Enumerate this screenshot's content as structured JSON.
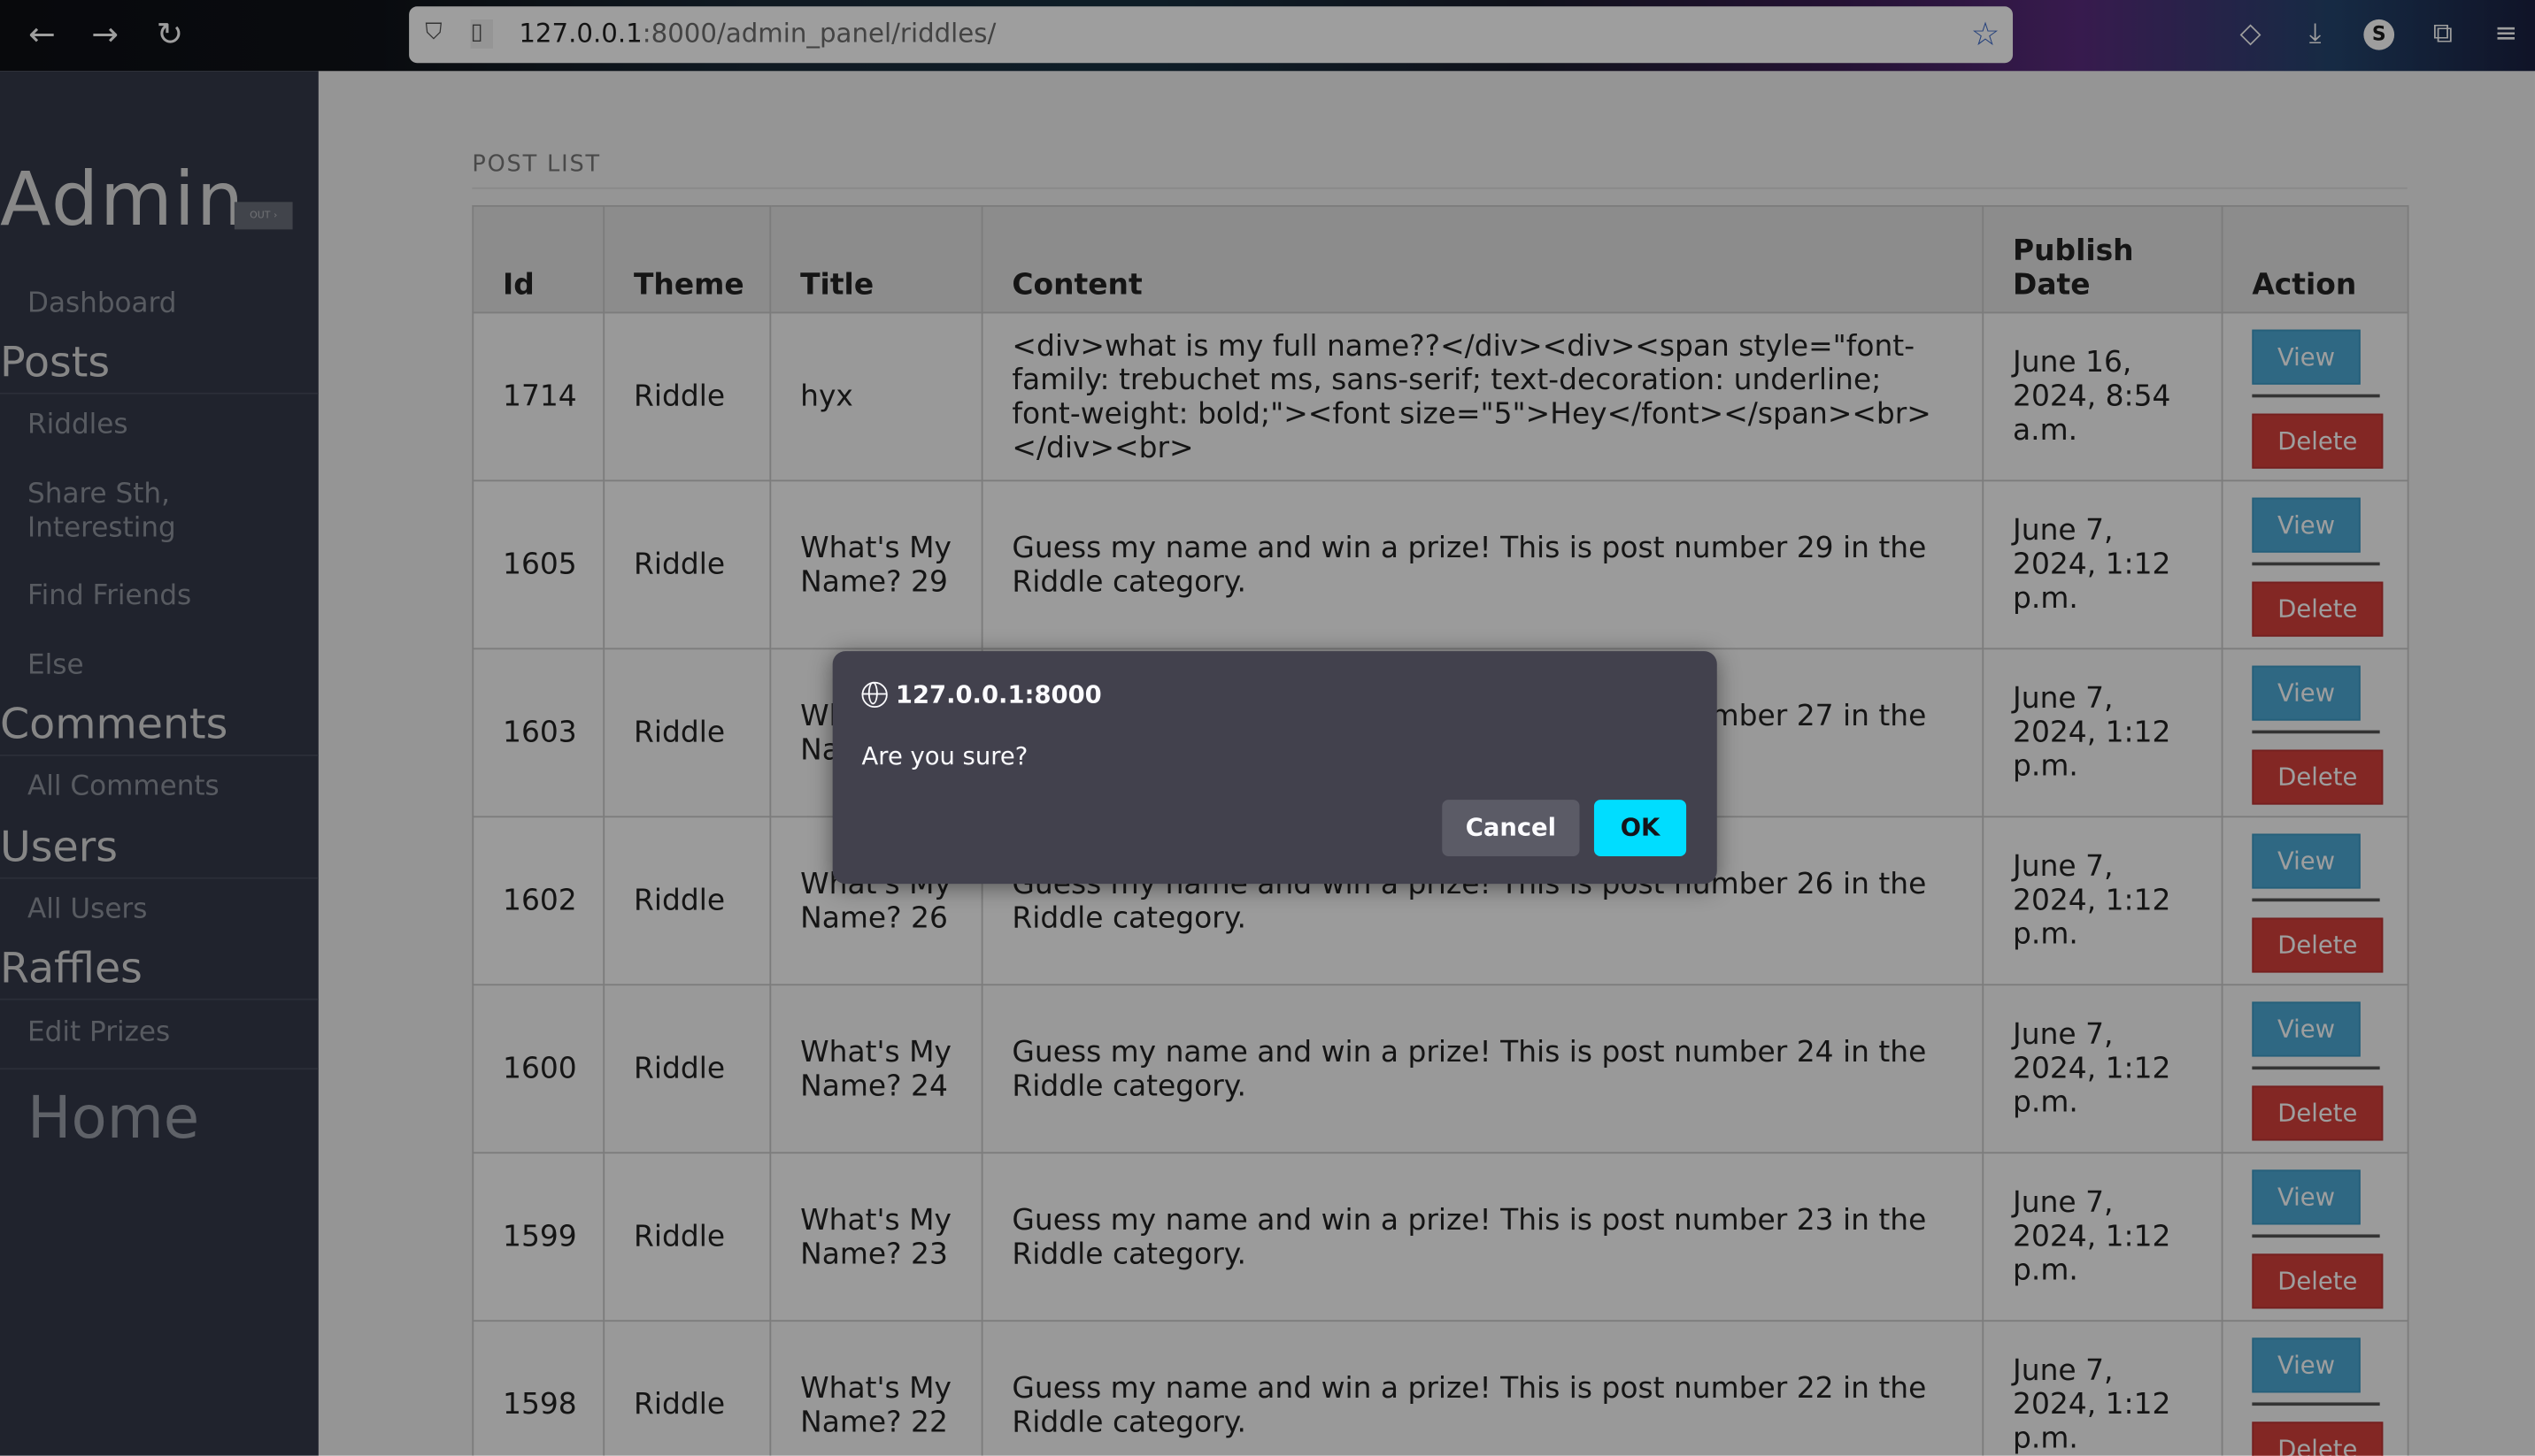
{
  "browser": {
    "url_host": "127.0.0.1",
    "url_path": ":8000/admin_panel/riddles/",
    "profile_initial": "S"
  },
  "sidebar": {
    "brand": "Admin",
    "logout_label": "OUT ›",
    "dashboard": "Dashboard",
    "sections": [
      {
        "title": "Posts",
        "items": [
          "Riddles",
          "Share Sth, Interesting",
          "Find Friends",
          "Else"
        ]
      },
      {
        "title": "Comments",
        "items": [
          "All Comments"
        ]
      },
      {
        "title": "Users",
        "items": [
          "All Users"
        ]
      },
      {
        "title": "Raffles",
        "items": [
          "Edit Prizes"
        ]
      }
    ],
    "home": "Home"
  },
  "main": {
    "title": "POST LIST",
    "columns": [
      "Id",
      "Theme",
      "Title",
      "Content",
      "Publish Date",
      "Action"
    ],
    "rows": [
      {
        "id": "1714",
        "theme": "Riddle",
        "title": "hyx",
        "content": "<div>what is my full name??</div><div><span style=\"font-family: trebuchet ms, sans-serif; text-decoration: underline; font-weight: bold;\"><font size=\"5\">Hey</font></span><br></div><br>",
        "date": "June 16, 2024, 8:54 a.m."
      },
      {
        "id": "1605",
        "theme": "Riddle",
        "title": "What's My Name? 29",
        "content": "Guess my name and win a prize! This is post number 29 in the Riddle category.",
        "date": "June 7, 2024, 1:12 p.m."
      },
      {
        "id": "1603",
        "theme": "Riddle",
        "title": "What's My Name? 27",
        "content": "Guess my name and win a prize! This is post number 27 in the Riddle category.",
        "date": "June 7, 2024, 1:12 p.m."
      },
      {
        "id": "1602",
        "theme": "Riddle",
        "title": "What's My Name? 26",
        "content": "Guess my name and win a prize! This is post number 26 in the Riddle category.",
        "date": "June 7, 2024, 1:12 p.m."
      },
      {
        "id": "1600",
        "theme": "Riddle",
        "title": "What's My Name? 24",
        "content": "Guess my name and win a prize! This is post number 24 in the Riddle category.",
        "date": "June 7, 2024, 1:12 p.m."
      },
      {
        "id": "1599",
        "theme": "Riddle",
        "title": "What's My Name? 23",
        "content": "Guess my name and win a prize! This is post number 23 in the Riddle category.",
        "date": "June 7, 2024, 1:12 p.m."
      },
      {
        "id": "1598",
        "theme": "Riddle",
        "title": "What's My Name? 22",
        "content": "Guess my name and win a prize! This is post number 22 in the Riddle category.",
        "date": "June 7, 2024, 1:12 p.m."
      }
    ],
    "view_label": "View",
    "delete_label": "Delete"
  },
  "dialog": {
    "origin": "127.0.0.1:8000",
    "message": "Are you sure?",
    "cancel": "Cancel",
    "ok": "OK"
  },
  "colors": {
    "sidebar_bg": "#34394a",
    "view_btn": "#4ca9d4",
    "delete_btn": "#d43f3a",
    "ok_btn": "#00ddff"
  }
}
